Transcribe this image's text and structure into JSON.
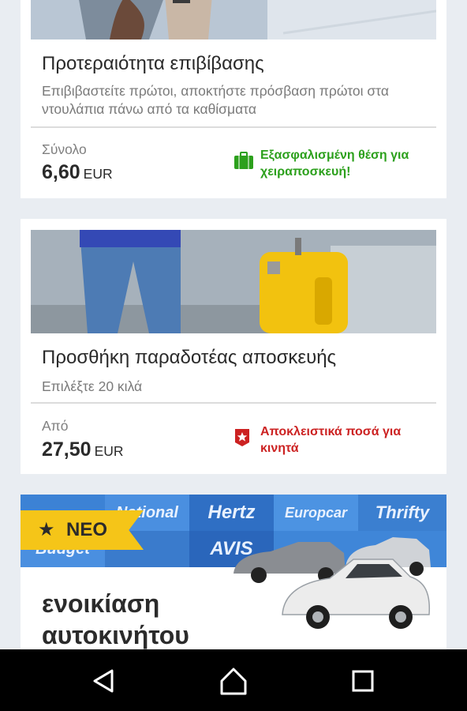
{
  "priority": {
    "title": "Προτεραιότητα επιβίβασης",
    "description": "Επιβιβαστείτε πρώτοι, αποκτήστε πρόσβαση πρώτοι στα ντουλάπια πάνω από τα καθίσματα",
    "price_label": "Σύνολο",
    "price_amount": "6,60",
    "currency": "EUR",
    "badge_text": "Εξασφαλισμένη θέση για χειραποσκευή!",
    "badge_icon": "suitcase-icon",
    "badge_color": "#2ca01c"
  },
  "baggage": {
    "title": "Προσθήκη παραδοτέας αποσκευής",
    "description": "Επιλέξτε 20 κιλά",
    "price_label": "Από",
    "price_amount": "27,50",
    "currency": "EUR",
    "badge_text": "Αποκλειστικά ποσά για κινητά",
    "badge_icon": "star-ribbon-icon",
    "badge_color": "#cc2222"
  },
  "car_rental": {
    "new_label": "NEO",
    "title_line1": "ενοικίαση",
    "title_line2": "αυτοκινήτου",
    "brands": [
      "National",
      "Hertz",
      "Europcar",
      "Thrifty",
      "Budget",
      "AVIS"
    ]
  },
  "nav": {
    "back_icon": "back-triangle-icon",
    "home_icon": "home-icon",
    "recents_icon": "recents-square-icon"
  }
}
